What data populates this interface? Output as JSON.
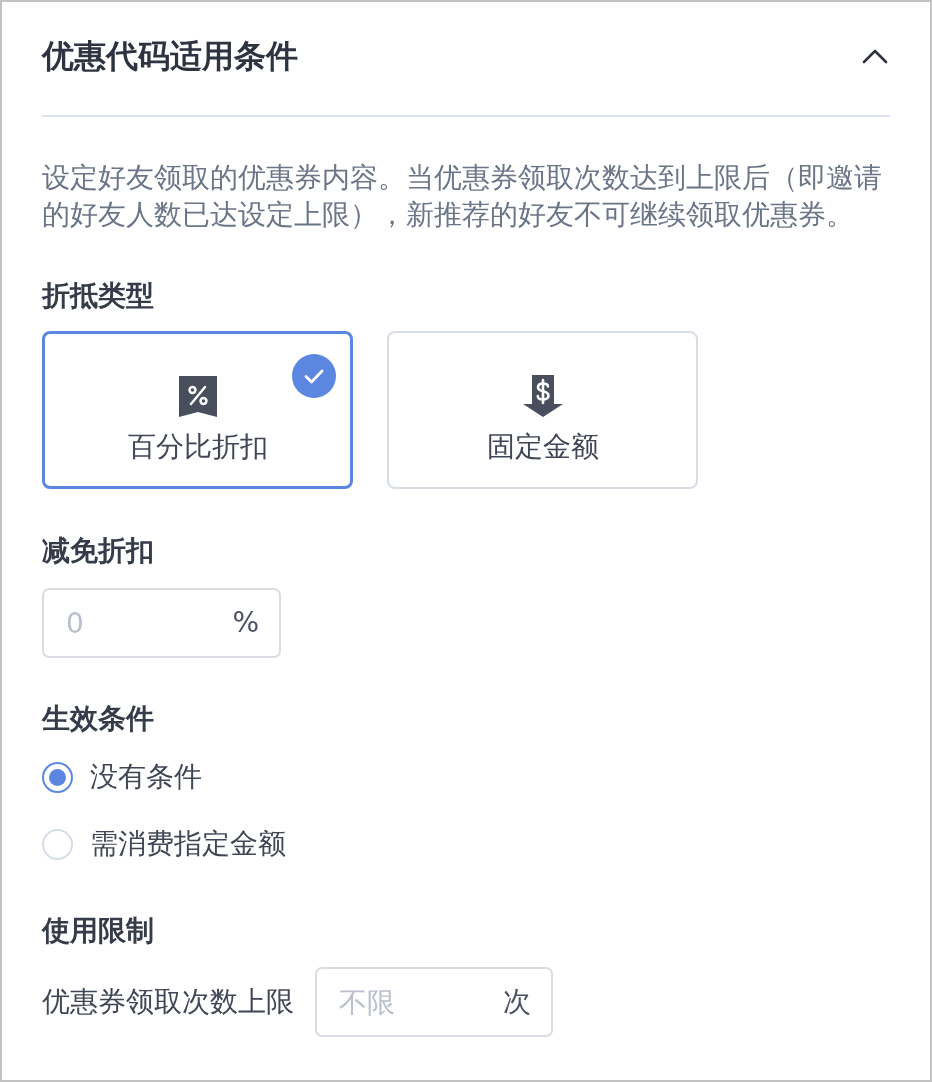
{
  "section": {
    "title": "优惠代码适用条件",
    "expanded": true
  },
  "description": "设定好友领取的优惠券内容。当优惠券领取次数达到上限后（即邀请的好友人数已达设定上限），新推荐的好友不可继续领取优惠券。",
  "discount_type": {
    "label": "折抵类型",
    "options": [
      {
        "kind": "percent",
        "label": "百分比折扣",
        "selected": true
      },
      {
        "kind": "fixed",
        "label": "固定金额",
        "selected": false
      }
    ]
  },
  "discount_amount": {
    "label": "减免折扣",
    "placeholder": "0",
    "suffix": "%"
  },
  "conditions": {
    "label": "生效条件",
    "options": [
      {
        "label": "没有条件",
        "selected": true
      },
      {
        "label": "需消费指定金额",
        "selected": false
      }
    ]
  },
  "usage_limit": {
    "label": "使用限制",
    "field_label": "优惠券领取次数上限",
    "placeholder": "不限",
    "suffix": "次"
  }
}
